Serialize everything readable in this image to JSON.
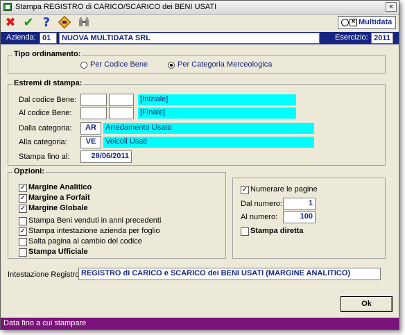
{
  "window": {
    "title": "Stampa REGISTRO di CARICO/SCARICO dei BENI USATI",
    "close_label": "×"
  },
  "toolbar": {
    "cancel": "✖",
    "confirm": "✔",
    "help": "?",
    "logo_text": "Multidata"
  },
  "header": {
    "azienda_label": "Azienda:",
    "azienda_code": "01",
    "azienda_name": "NUOVA MULTIDATA SRL",
    "esercizio_label": "Esercizio:",
    "esercizio_value": "2011"
  },
  "ordinamento": {
    "legend": "Tipo ordinamento:",
    "option1": "Per Codice Bene",
    "option2": "Per Categoria Merceologica",
    "selected": "Per Categoria Merceologica"
  },
  "estremi": {
    "legend": "Estremi di stampa:",
    "dal_codice_label": "Dal codice Bene:",
    "dal_codice_desc": "[Iniziale]",
    "al_codice_label": "Al codice Bene:",
    "al_codice_desc": "[Finale]",
    "dalla_categoria_label": "Dalla categoria:",
    "dalla_categoria_code": "AR",
    "dalla_categoria_desc": "Arredamento Usato",
    "alla_categoria_label": "Alla categoria:",
    "alla_categoria_code": "VE",
    "alla_categoria_desc": "Veicoli Usati",
    "stampa_fino_label": "Stampa fino al:",
    "stampa_fino_value": "28/06/2011"
  },
  "opzioni": {
    "legend": "Opzioni:",
    "margine_analitico": {
      "label": "Margine Analitico",
      "checked": true
    },
    "margine_forfait": {
      "label": "Margine a Forfait",
      "checked": true
    },
    "margine_globale": {
      "label": "Margine Globale",
      "checked": true
    },
    "beni_venduti": {
      "label": "Stampa Beni venduti in anni precedenti",
      "checked": false
    },
    "intestazione_foglio": {
      "label": "Stampa intestazione azienda per foglio",
      "checked": true
    },
    "salta_pagina": {
      "label": "Salta pagina al cambio del codice",
      "checked": false
    },
    "stampa_ufficiale": {
      "label": "Stampa Ufficiale",
      "checked": false
    }
  },
  "pagine": {
    "numerare": {
      "label": "Numerare le pagine",
      "checked": true
    },
    "dal_numero_label": "Dal numero:",
    "dal_numero_value": "1",
    "al_numero_label": "Al numero:",
    "al_numero_value": "100",
    "stampa_diretta": {
      "label": "Stampa diretta",
      "checked": false
    }
  },
  "intestazione": {
    "label": "Intestazione Registro:",
    "value": "REGISTRO di CARICO e SCARICO dei BENI USATI (MARGINE ANALITICO)"
  },
  "ok_button": "Ok",
  "status": "Data fino a cui stampare"
}
